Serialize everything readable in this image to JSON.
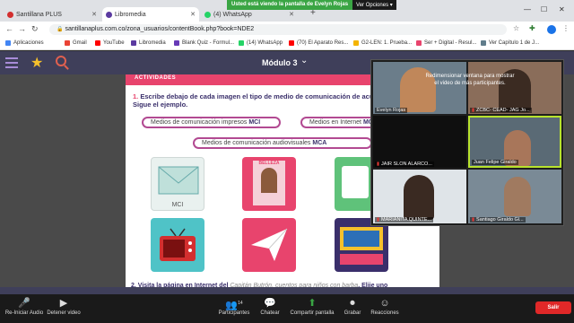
{
  "browser": {
    "tabs": [
      {
        "title": "Santillana PLUS",
        "active": false
      },
      {
        "title": "Libromedia",
        "active": true
      },
      {
        "title": "(4) WhatsApp",
        "active": false
      }
    ],
    "new_tab": "+",
    "url": "santillanaplus.com.co/zona_usuarios/contentBook.php?book=NDE2",
    "bookmarks": [
      "Aplicaciones",
      "Gmail",
      "YouTube",
      "Libromedia",
      "Blank Quiz - Formul...",
      "(14) WhatsApp",
      "(70) El Aparato Res...",
      "G2-LEN: 1. Prueba...",
      "Ser + Digital - Resul...",
      "Ver Capítulo 1 de J..."
    ]
  },
  "share": {
    "banner": "Usted está viendo la pantalla de Evelyn Rojas",
    "options": "Ver Opciones ▾"
  },
  "app": {
    "module_title": "Módulo 3",
    "module_chevron": "⌄"
  },
  "activity": {
    "banner_label": "ACTIVIDADES",
    "instruction_num": "1.",
    "instruction": "Escribe debajo de cada imagen el tipo de medio de comunicación de acuerdo con la clave. Sigue el ejemplo.",
    "pills": [
      {
        "text": "Medios de comunicación impresos",
        "code": "MCI"
      },
      {
        "text": "Medios en Internet",
        "code": "MCI"
      },
      {
        "text": "Medios de comunicación audiovisuales",
        "code": "MCA"
      }
    ],
    "card_label": "MCI",
    "magazine_text": "BELLEZA",
    "q2_num": "2.",
    "q2_text": "Visita la página en Internet del",
    "q2_italic": "Capitán Butrón, cuentos para niños con barba",
    "q2_end": ". Elije uno"
  },
  "video": {
    "resize_message": "Redimensionar ventana para mostrar el video de más participantes.",
    "participants": [
      {
        "name": "Evelyn Rojas",
        "muted": false
      },
      {
        "name": "ZCBC- CEAD- JAG Jo...",
        "muted": true
      },
      {
        "name": "JAIR SLON ALARCO...",
        "muted": true
      },
      {
        "name": "Juan Felipe Giraldo",
        "muted": false
      },
      {
        "name": "MARIANITA QUINTE...",
        "muted": true
      },
      {
        "name": "Santiago Giraldo Gl...",
        "muted": true
      }
    ]
  },
  "toolbar": {
    "buttons": [
      {
        "label": "Re-Iniciar Audio",
        "icon": "🎤"
      },
      {
        "label": "Detener video",
        "icon": "▶"
      },
      {
        "label": "Participantes",
        "icon": "👥",
        "count": "14"
      },
      {
        "label": "Chatear",
        "icon": "💬"
      },
      {
        "label": "Compartir pantalla",
        "icon": "⬆"
      },
      {
        "label": "Grabar",
        "icon": "⏺"
      },
      {
        "label": "Reacciones",
        "icon": "☺"
      }
    ],
    "leave": "Salir"
  },
  "colors": {
    "accent_pink": "#e8446d",
    "app_header": "#3f3f5a",
    "share_green": "#3aa544",
    "leave_red": "#e02828"
  }
}
